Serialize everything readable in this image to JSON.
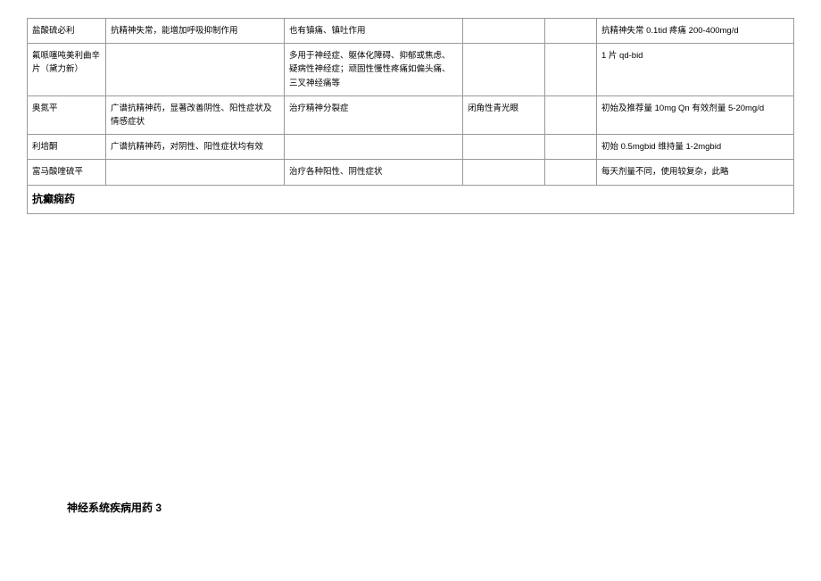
{
  "table": {
    "rows": [
      {
        "c1": "盐酸硫必利",
        "c2": "抗精神失常，能增加呼吸抑制作用",
        "c3": "也有镇痛、镇吐作用",
        "c4": "",
        "c5": "",
        "c6": "抗精神失常 0.1tid 疼痛 200-400mg/d"
      },
      {
        "c1": "氟哌噻吨美利曲辛片（黛力新）",
        "c2": "",
        "c3": "多用于神经症、躯体化障碍、抑郁或焦虑、疑病性神经症；顽固性慢性疼痛如偏头痛、三叉神经痛等",
        "c4": "",
        "c5": "",
        "c6": "1 片 qd-bid"
      },
      {
        "c1": "奥氮平",
        "c2": "广谱抗精神药，显著改善阴性、阳性症状及情感症状",
        "c3": "治疗精神分裂症",
        "c4": "闭角性青光眼",
        "c5": "",
        "c6": "初始及推荐量 10mg Qn 有效剂量 5-20mg/d"
      },
      {
        "c1": "利培酮",
        "c2": "广谱抗精神药，对阴性、阳性症状均有效",
        "c3": "",
        "c4": "",
        "c5": "",
        "c6": "初始 0.5mgbid  维持量 1-2mgbid"
      },
      {
        "c1": "富马酸喹硫平",
        "c2": "",
        "c3": "治疗各种阳性、阴性症状",
        "c4": "",
        "c5": "",
        "c6": "每天剂量不同，使用较复杂，此略"
      }
    ],
    "section_header": "抗癫痫药"
  },
  "footer": "神经系统疾病用药 3"
}
